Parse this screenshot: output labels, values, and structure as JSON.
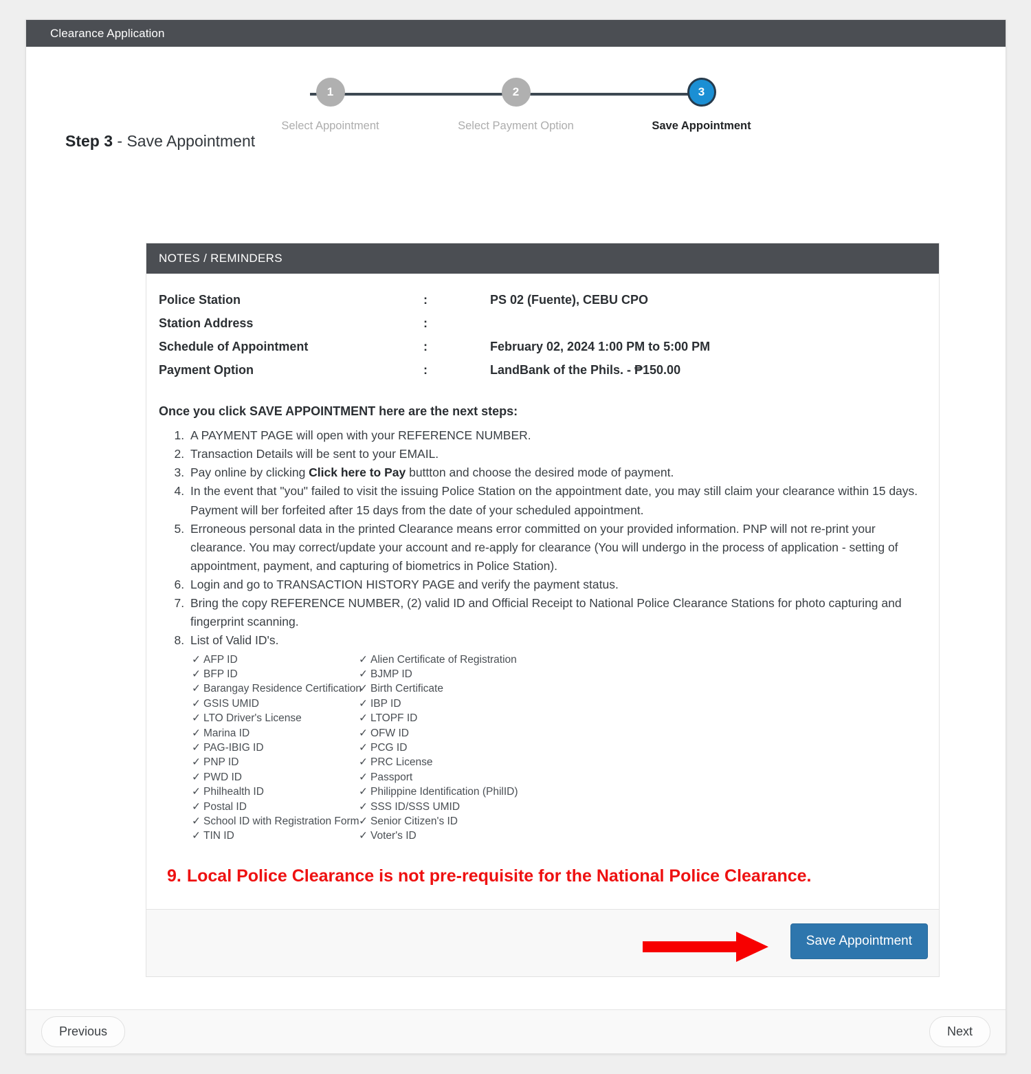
{
  "window": {
    "title": "Clearance Application"
  },
  "stepper": {
    "steps": [
      {
        "number": "1",
        "label": "Select Appointment",
        "active": false
      },
      {
        "number": "2",
        "label": "Select Payment Option",
        "active": false
      },
      {
        "number": "3",
        "label": "Save Appointment",
        "active": true
      }
    ],
    "active_color": "#1b8fd4",
    "inactive_color": "#b0b0b0"
  },
  "page": {
    "step_prefix": "Step 3",
    "step_suffix": " - Save Appointment"
  },
  "notes_card": {
    "header": "NOTES / REMINDERS",
    "info": [
      {
        "label": "Police Station",
        "colon": ":",
        "value": "PS 02 (Fuente), CEBU CPO"
      },
      {
        "label": "Station Address",
        "colon": ":",
        "value": ""
      },
      {
        "label": "Schedule of Appointment",
        "colon": ":",
        "value": "February 02, 2024 1:00 PM to 5:00 PM"
      },
      {
        "label": "Payment Option",
        "colon": ":",
        "value": "LandBank of the Phils. - ₱150.00"
      }
    ],
    "next_steps_title": "Once you click SAVE APPOINTMENT here are the next steps:",
    "steps": {
      "s1": "A PAYMENT PAGE will open with your REFERENCE NUMBER.",
      "s2": "Transaction Details will be sent to your EMAIL.",
      "s3_a": "Pay online by clicking ",
      "s3_b": "Click here to Pay",
      "s3_c": " buttton and choose the desired mode of payment.",
      "s4": "In the event that \"you\" failed to visit the issuing Police Station on the appointment date, you may still claim your clearance within 15 days. Payment will ber forfeited after 15 days from the date of your scheduled appointment.",
      "s5": "Erroneous personal data in the printed Clearance means error committed on your provided information. PNP will not re-print your clearance. You may correct/update your account and re-apply for clearance (You will undergo in the process of application - setting of appointment, payment, and capturing of biometrics in Police Station).",
      "s6": "Login and go to TRANSACTION HISTORY PAGE and verify the payment status.",
      "s7": "Bring the copy REFERENCE NUMBER, (2) valid ID and Official Receipt to National Police Clearance Stations for photo capturing and fingerprint scanning.",
      "s8": "List of Valid ID's."
    },
    "valid_ids": {
      "check_glyph": "✓",
      "left": [
        "AFP ID",
        "BFP ID",
        "Barangay Residence Certification",
        "GSIS UMID",
        "LTO Driver's License",
        "Marina ID",
        "PAG-IBIG ID",
        "PNP ID",
        "PWD ID",
        "Philhealth ID",
        "Postal ID",
        "School ID with Registration Form",
        "TIN ID"
      ],
      "right": [
        "Alien Certificate of Registration",
        "BJMP ID",
        "Birth Certificate",
        "IBP ID",
        "LTOPF ID",
        "OFW ID",
        "PCG ID",
        "PRC License",
        "Passport",
        "Philippine Identification (PhilID)",
        "SSS ID/SSS UMID",
        "Senior Citizen's ID",
        "Voter's ID"
      ]
    },
    "red_note": {
      "number": "9.",
      "text": "Local Police Clearance is not pre-requisite for the National Police Clearance.",
      "color": "#ee1111"
    },
    "save_button": "Save Appointment",
    "arrow_color": "#f70000"
  },
  "footer": {
    "previous": "Previous",
    "next": "Next"
  }
}
